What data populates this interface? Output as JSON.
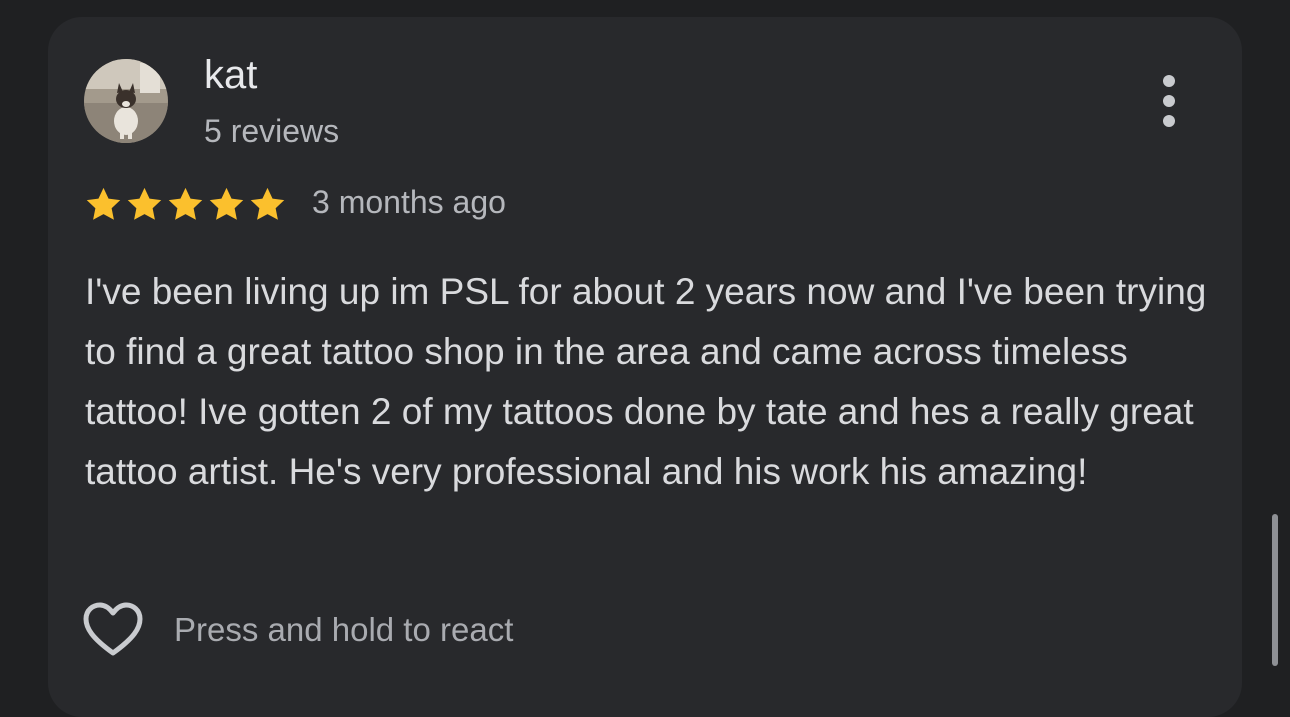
{
  "review": {
    "author": {
      "name": "kat",
      "review_count": "5 reviews",
      "avatar_icon": "dog-photo-avatar"
    },
    "rating": 5,
    "rating_max": 5,
    "time": "3 months ago",
    "text": "I've been living up im PSL for about 2 years now and I've been trying to find a great tattoo shop in the area and came across timeless tattoo! Ive gotten 2 of my tattoos done by tate and hes a really great tattoo artist. He's very professional and his work his amazing!",
    "more_icon": "more-vert-icon",
    "react": {
      "icon": "heart-outline-icon",
      "label": "Press and hold to react"
    }
  },
  "colors": {
    "background": "#1f2022",
    "card": "#28292c",
    "star": "#fbc02d",
    "primary_text": "#e8e9ec",
    "secondary_text": "#b5b7bc"
  }
}
